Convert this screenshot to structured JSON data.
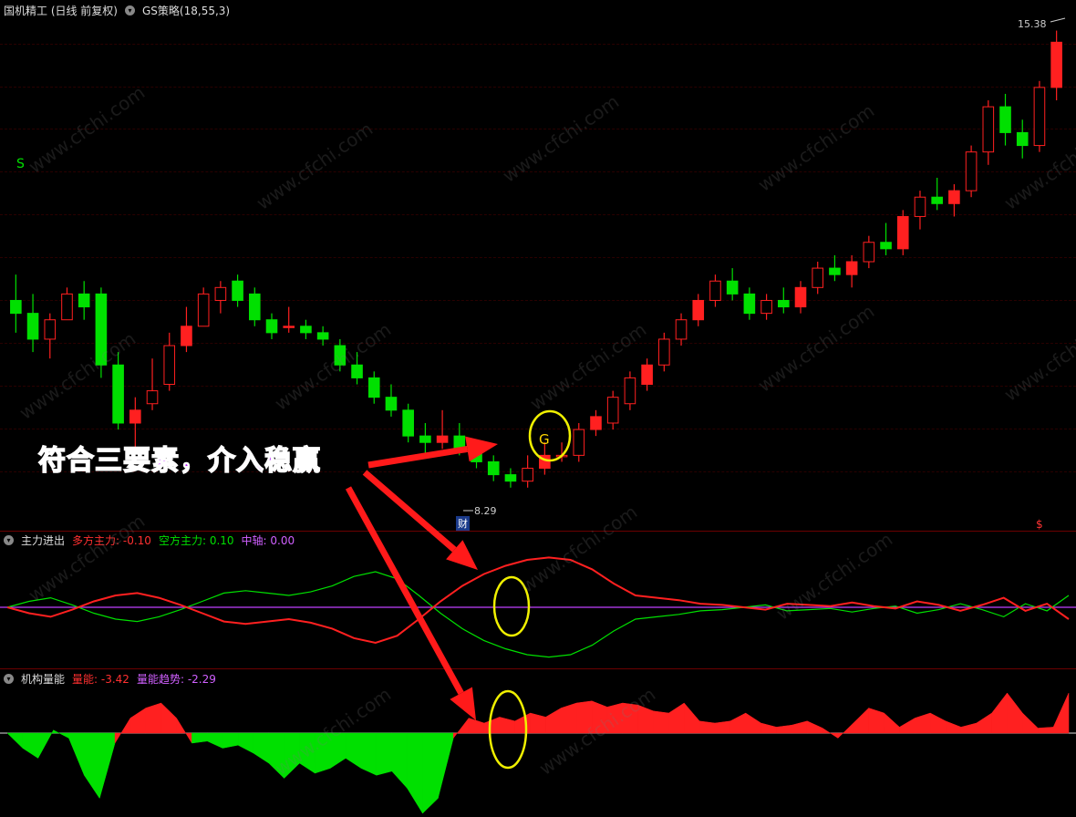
{
  "main_header": {
    "title": "国机精工 (日线 前复权)",
    "indicator": "GS策略",
    "params": "(18,55,3)"
  },
  "main_labels": {
    "high_price": "15.38",
    "low_price": "8.29",
    "signal_s": "S",
    "signal_g": "G",
    "financial_mark": "财",
    "dollar_mark": "$"
  },
  "callout": "符合三要素，介入稳赢",
  "panel2": {
    "title": "主力进出",
    "long_label": "多方主力:",
    "long_value": "-0.10",
    "short_label": "空方主力:",
    "short_value": "0.10",
    "axis_label": "中轴:",
    "axis_value": "0.00"
  },
  "panel3": {
    "title": "机构量能",
    "energy_label": "量能:",
    "energy_value": "-3.42",
    "trend_label": "量能趋势:",
    "trend_value": "-2.29"
  },
  "colors": {
    "up": "#ff2020",
    "down": "#00e000",
    "midline": "#c040ff",
    "highlight": "#f0f000"
  },
  "chart_data": [
    {
      "type": "candlestick",
      "title": "国机精工 (日线 前复权)",
      "ohlc": [
        [
          11.2,
          11.6,
          10.7,
          11.0
        ],
        [
          11.0,
          11.3,
          10.4,
          10.6
        ],
        [
          10.6,
          11.0,
          10.3,
          10.9
        ],
        [
          10.9,
          11.4,
          10.9,
          11.3
        ],
        [
          11.3,
          11.5,
          10.9,
          11.1
        ],
        [
          11.3,
          11.4,
          10.0,
          10.2
        ],
        [
          10.2,
          10.4,
          9.2,
          9.3
        ],
        [
          9.3,
          9.7,
          8.9,
          9.5
        ],
        [
          9.6,
          10.3,
          9.5,
          9.8
        ],
        [
          9.9,
          10.7,
          9.8,
          10.5
        ],
        [
          10.5,
          11.1,
          10.4,
          10.8
        ],
        [
          10.8,
          11.4,
          10.8,
          11.3
        ],
        [
          11.2,
          11.5,
          11.0,
          11.4
        ],
        [
          11.5,
          11.6,
          11.1,
          11.2
        ],
        [
          11.3,
          11.4,
          10.8,
          10.9
        ],
        [
          10.9,
          11.0,
          10.6,
          10.7
        ],
        [
          10.8,
          11.1,
          10.7,
          10.8
        ],
        [
          10.8,
          10.9,
          10.6,
          10.7
        ],
        [
          10.7,
          10.8,
          10.5,
          10.6
        ],
        [
          10.5,
          10.6,
          10.1,
          10.2
        ],
        [
          10.2,
          10.4,
          9.9,
          10.0
        ],
        [
          10.0,
          10.1,
          9.6,
          9.7
        ],
        [
          9.7,
          9.9,
          9.4,
          9.5
        ],
        [
          9.5,
          9.6,
          9.0,
          9.1
        ],
        [
          9.1,
          9.3,
          8.8,
          9.0
        ],
        [
          9.0,
          9.5,
          8.9,
          9.1
        ],
        [
          9.1,
          9.3,
          8.8,
          8.9
        ],
        [
          8.9,
          9.0,
          8.6,
          8.7
        ],
        [
          8.7,
          8.8,
          8.4,
          8.5
        ],
        [
          8.5,
          8.6,
          8.3,
          8.4
        ],
        [
          8.4,
          8.8,
          8.3,
          8.6
        ],
        [
          8.6,
          9.0,
          8.5,
          8.8
        ],
        [
          8.8,
          9.0,
          8.7,
          8.8
        ],
        [
          8.8,
          9.3,
          8.7,
          9.2
        ],
        [
          9.2,
          9.5,
          9.1,
          9.4
        ],
        [
          9.3,
          9.8,
          9.2,
          9.7
        ],
        [
          9.6,
          10.1,
          9.5,
          10.0
        ],
        [
          9.9,
          10.3,
          9.8,
          10.2
        ],
        [
          10.2,
          10.7,
          10.1,
          10.6
        ],
        [
          10.6,
          11.0,
          10.5,
          10.9
        ],
        [
          10.9,
          11.3,
          10.8,
          11.2
        ],
        [
          11.2,
          11.6,
          11.1,
          11.5
        ],
        [
          11.5,
          11.7,
          11.2,
          11.3
        ],
        [
          11.3,
          11.4,
          10.9,
          11.0
        ],
        [
          11.0,
          11.3,
          10.9,
          11.2
        ],
        [
          11.2,
          11.4,
          11.0,
          11.1
        ],
        [
          11.1,
          11.5,
          11.0,
          11.4
        ],
        [
          11.4,
          11.8,
          11.3,
          11.7
        ],
        [
          11.7,
          11.9,
          11.5,
          11.6
        ],
        [
          11.6,
          11.9,
          11.4,
          11.8
        ],
        [
          11.8,
          12.2,
          11.7,
          12.1
        ],
        [
          12.1,
          12.4,
          11.9,
          12.0
        ],
        [
          12.0,
          12.6,
          11.9,
          12.5
        ],
        [
          12.5,
          12.9,
          12.3,
          12.8
        ],
        [
          12.8,
          13.1,
          12.6,
          12.7
        ],
        [
          12.7,
          13.0,
          12.5,
          12.9
        ],
        [
          12.9,
          13.6,
          12.8,
          13.5
        ],
        [
          13.5,
          14.3,
          13.3,
          14.2
        ],
        [
          14.2,
          14.4,
          13.6,
          13.8
        ],
        [
          13.8,
          14.0,
          13.4,
          13.6
        ],
        [
          13.6,
          14.6,
          13.5,
          14.5
        ],
        [
          14.5,
          15.38,
          14.3,
          15.2
        ]
      ]
    },
    {
      "type": "line",
      "title": "主力进出",
      "series": [
        {
          "name": "多方主力",
          "values": [
            0.0,
            -0.05,
            -0.08,
            -0.02,
            0.05,
            0.1,
            0.12,
            0.08,
            0.02,
            -0.05,
            -0.12,
            -0.14,
            -0.12,
            -0.1,
            -0.13,
            -0.18,
            -0.26,
            -0.3,
            -0.24,
            -0.1,
            0.05,
            0.18,
            0.28,
            0.35,
            0.4,
            0.42,
            0.4,
            0.32,
            0.2,
            0.1,
            0.08,
            0.06,
            0.03,
            0.02,
            0.0,
            -0.02,
            0.03,
            0.02,
            0.01,
            0.04,
            0.01,
            -0.01,
            0.05,
            0.02,
            -0.03,
            0.02,
            0.08,
            -0.03,
            0.03,
            -0.1
          ]
        },
        {
          "name": "空方主力",
          "values": [
            0.0,
            0.05,
            0.08,
            0.02,
            -0.05,
            -0.1,
            -0.12,
            -0.08,
            -0.02,
            0.05,
            0.12,
            0.14,
            0.12,
            0.1,
            0.13,
            0.18,
            0.26,
            0.3,
            0.24,
            0.1,
            -0.05,
            -0.18,
            -0.28,
            -0.35,
            -0.4,
            -0.42,
            -0.4,
            -0.32,
            -0.2,
            -0.1,
            -0.08,
            -0.06,
            -0.03,
            -0.02,
            0.0,
            0.02,
            -0.03,
            -0.02,
            -0.01,
            -0.04,
            -0.01,
            0.01,
            -0.05,
            -0.02,
            0.03,
            -0.02,
            -0.08,
            0.03,
            -0.03,
            0.1
          ]
        },
        {
          "name": "中轴",
          "values": [
            0,
            0
          ]
        }
      ]
    },
    {
      "type": "area",
      "title": "机构量能",
      "series": [
        {
          "name": "量能",
          "values": [
            0,
            -1.5,
            -2.5,
            0.3,
            -0.5,
            -4.2,
            -6.5,
            -1.0,
            1.5,
            2.5,
            3.0,
            1.5,
            -1.0,
            -0.8,
            -1.5,
            -1.2,
            -2.0,
            -3.0,
            -4.5,
            -3.0,
            -4.0,
            -3.5,
            -2.5,
            -3.5,
            -4.2,
            -3.8,
            -5.5,
            -8.0,
            -6.5,
            -0.5,
            1.5,
            1.0,
            1.6,
            1.2,
            2.0,
            1.6,
            2.5,
            3.0,
            3.2,
            2.6,
            3.0,
            2.8,
            2.2,
            2.0,
            3.0,
            1.2,
            1.0,
            1.2,
            2.0,
            1.0,
            0.6,
            0.8,
            1.2,
            0.5,
            -0.5,
            1.0,
            2.5,
            2.0,
            0.6,
            1.5,
            2.0,
            1.2,
            0.6,
            1.0,
            2.0,
            4.0,
            2.0,
            0.5,
            0.6,
            4.0
          ]
        }
      ]
    }
  ]
}
